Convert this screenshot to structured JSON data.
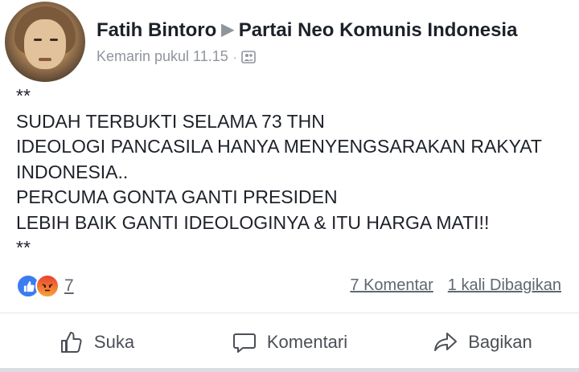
{
  "post": {
    "author": "Fatih Bintoro",
    "group": "Partai Neo Komunis Indonesia",
    "timestamp": "Kemarin pukul 11.15",
    "separator": "·",
    "privacy_icon": "group-privacy-icon",
    "body_lines": [
      "**",
      "SUDAH TERBUKTI SELAMA 73 THN",
      "IDEOLOGI PANCASILA HANYA MENYENGSARAKAN RAKYAT",
      "INDONESIA..",
      "PERCUMA GONTA GANTI PRESIDEN",
      "LEBIH BAIK GANTI IDEOLOGINYA & ITU HARGA MATI!!",
      "**"
    ]
  },
  "stats": {
    "reaction_icons": [
      "like-reaction-icon",
      "angry-reaction-icon"
    ],
    "reaction_count": "7",
    "comments": "7 Komentar",
    "shares": "1 kali Dibagikan"
  },
  "actions": {
    "like": "Suka",
    "comment": "Komentari",
    "share": "Bagikan"
  },
  "colors": {
    "text": "#1d2129",
    "meta": "#90949c",
    "like_blue": "#3b7cf0",
    "angry_red": "#e9412d"
  }
}
